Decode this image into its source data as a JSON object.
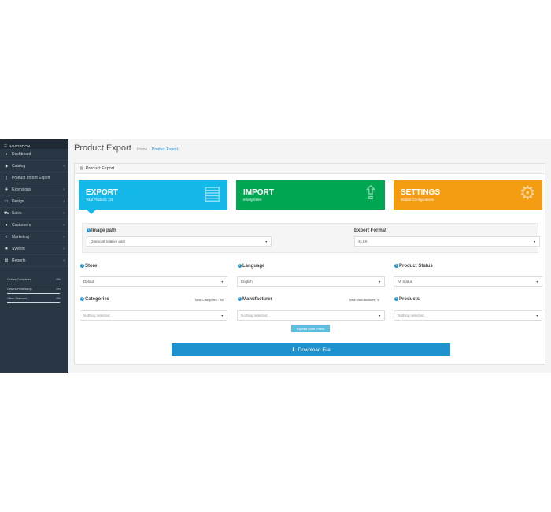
{
  "sidebar": {
    "heading": "NAVIGATION",
    "items": [
      {
        "label": "Dashboard",
        "icon": "dashboard-icon",
        "chevron": false
      },
      {
        "label": "Catalog",
        "icon": "tag-icon",
        "chevron": true
      },
      {
        "label": "Product Import Export",
        "icon": "file-icon",
        "chevron": false
      },
      {
        "label": "Extensions",
        "icon": "puzzle-icon",
        "chevron": true
      },
      {
        "label": "Design",
        "icon": "monitor-icon",
        "chevron": true
      },
      {
        "label": "Sales",
        "icon": "cart-icon",
        "chevron": true
      },
      {
        "label": "Customers",
        "icon": "user-icon",
        "chevron": true
      },
      {
        "label": "Marketing",
        "icon": "share-icon",
        "chevron": true
      },
      {
        "label": "System",
        "icon": "cog-icon",
        "chevron": true
      },
      {
        "label": "Reports",
        "icon": "bar-chart-icon",
        "chevron": true
      }
    ],
    "stats": [
      {
        "label": "Orders Completed",
        "value": "0%",
        "fraction": 0.98
      },
      {
        "label": "Orders Processing",
        "value": "0%",
        "fraction": 0.98
      },
      {
        "label": "Other Statuses",
        "value": "0%",
        "fraction": 0.98
      }
    ]
  },
  "header": {
    "title": "Product Export",
    "breadcrumb": [
      "Home",
      "Product Export"
    ]
  },
  "panel": {
    "heading": "Product Export"
  },
  "tiles": {
    "export": {
      "title": "EXPORT",
      "subtitle": "Total Products : 19",
      "color": "#14b9ea"
    },
    "import": {
      "title": "IMPORT",
      "subtitle": "Infinity Items",
      "color": "#00a651"
    },
    "settings": {
      "title": "SETTINGS",
      "subtitle": "Module Configurations",
      "color": "#f39c12"
    }
  },
  "image_path": {
    "label": "Image path",
    "value": "Opencart relative path"
  },
  "export_format": {
    "label": "Export Format",
    "value": "XLSX"
  },
  "filters": {
    "store": {
      "label": "Store",
      "value": "Default"
    },
    "language": {
      "label": "Language",
      "value": "English"
    },
    "product_status": {
      "label": "Product Status",
      "value": "All Status"
    },
    "categories": {
      "label": "Categories",
      "count": "Total Categories : 38",
      "placeholder": "Nothing selected"
    },
    "manufacturer": {
      "label": "Manufacturer",
      "count": "Total Manufacturer : 6",
      "placeholder": "Nothing selected"
    },
    "products": {
      "label": "Products",
      "placeholder": "Nothing selected"
    }
  },
  "expand_button": "Expand More Filters",
  "download_button": "Download File",
  "colors": {
    "accent": "#1e91cf",
    "sidebar": "#293744"
  }
}
